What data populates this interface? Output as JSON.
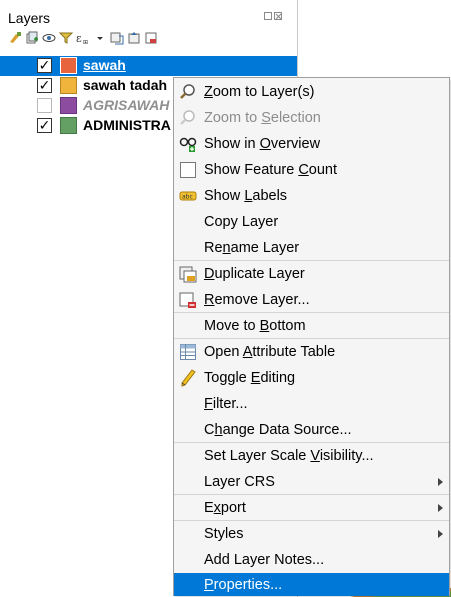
{
  "panel": {
    "title": "Layers"
  },
  "layers": [
    {
      "name": "sawah",
      "checked": true,
      "color": "#e8643c",
      "selected": true
    },
    {
      "name": "sawah tadah",
      "checked": true,
      "color": "#f0b43c",
      "selected": false
    },
    {
      "name": "AGRISAWAH",
      "checked": false,
      "color": "#8c4ca0",
      "selected": false
    },
    {
      "name": "ADMINISTRA",
      "checked": true,
      "color": "#64a064",
      "selected": false
    }
  ],
  "checkmark": "✓",
  "menu": {
    "items": [
      {
        "pre": "",
        "ul": "Z",
        "post": "oom to Layer(s)",
        "icon": "zoom-layer-icon",
        "disabled": false
      },
      {
        "pre": "Zoom to ",
        "ul": "S",
        "post": "election",
        "icon": "zoom-selection-icon",
        "disabled": true
      },
      {
        "pre": "Show in ",
        "ul": "O",
        "post": "verview",
        "icon": "overview-icon",
        "disabled": false
      },
      {
        "pre": "Show Feature ",
        "ul": "C",
        "post": "ount",
        "icon": "feature-count-checkbox",
        "disabled": false
      },
      {
        "pre": "Show ",
        "ul": "L",
        "post": "abels",
        "icon": "labels-icon",
        "disabled": false
      },
      {
        "pre": "Copy Layer",
        "ul": "",
        "post": "",
        "icon": "",
        "disabled": false
      },
      {
        "pre": "Re",
        "ul": "n",
        "post": "ame Layer",
        "icon": "",
        "disabled": false
      },
      {
        "pre": "",
        "ul": "D",
        "post": "uplicate Layer",
        "icon": "duplicate-layer-icon",
        "disabled": false
      },
      {
        "pre": "",
        "ul": "R",
        "post": "emove Layer...",
        "icon": "remove-layer-icon",
        "disabled": false
      },
      {
        "pre": "Move to ",
        "ul": "B",
        "post": "ottom",
        "icon": "",
        "disabled": false
      },
      {
        "pre": "Open ",
        "ul": "A",
        "post": "ttribute Table",
        "icon": "attribute-table-icon",
        "disabled": false
      },
      {
        "pre": "Toggle ",
        "ul": "E",
        "post": "diting",
        "icon": "pencil-icon",
        "disabled": false
      },
      {
        "pre": "",
        "ul": "F",
        "post": "ilter...",
        "icon": "",
        "disabled": false
      },
      {
        "pre": "C",
        "ul": "h",
        "post": "ange Data Source...",
        "icon": "",
        "disabled": false
      },
      {
        "pre": "Set Layer Scale ",
        "ul": "V",
        "post": "isibility...",
        "icon": "",
        "disabled": false
      },
      {
        "pre": "Layer CRS",
        "ul": "",
        "post": "",
        "icon": "",
        "disabled": false
      },
      {
        "pre": "E",
        "ul": "x",
        "post": "port",
        "icon": "",
        "disabled": false
      },
      {
        "pre": "Styles",
        "ul": "",
        "post": "",
        "icon": "",
        "disabled": false
      },
      {
        "pre": "Add Layer Notes...",
        "ul": "",
        "post": "",
        "icon": "",
        "disabled": false
      },
      {
        "pre": "",
        "ul": "P",
        "post": "roperties...",
        "icon": "",
        "disabled": false
      }
    ]
  },
  "colors": {
    "selection": "#0078d7",
    "menu_bg": "#f5f5f5"
  }
}
